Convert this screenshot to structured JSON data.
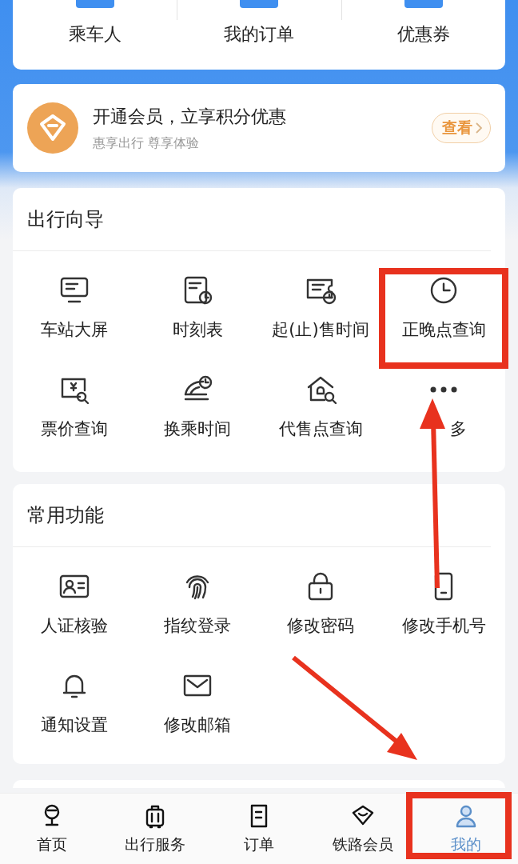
{
  "shortcuts": [
    {
      "label": "乘车人"
    },
    {
      "label": "我的订单"
    },
    {
      "label": "优惠券"
    }
  ],
  "membership_banner": {
    "title": "开通会员，立享积分优惠",
    "subtitle": "惠享出行 尊享体验",
    "button": "查看"
  },
  "sections": [
    {
      "title": "出行向导",
      "items": [
        {
          "label": "车站大屏",
          "kind": "normal"
        },
        {
          "label": "时刻表",
          "kind": "normal"
        },
        {
          "label": "起(止)售时间",
          "kind": "normal"
        },
        {
          "label": "正晚点查询",
          "kind": "normal"
        },
        {
          "label": "票价查询",
          "kind": "normal"
        },
        {
          "label": "换乘时间",
          "kind": "normal"
        },
        {
          "label": "代售点查询",
          "kind": "normal"
        },
        {
          "label": "多",
          "kind": "more"
        }
      ]
    },
    {
      "title": "常用功能",
      "items": [
        {
          "label": "人证核验",
          "kind": "normal"
        },
        {
          "label": "指纹登录",
          "kind": "normal"
        },
        {
          "label": "修改密码",
          "kind": "normal"
        },
        {
          "label": "修改手机号",
          "kind": "normal"
        },
        {
          "label": "通知设置",
          "kind": "normal"
        },
        {
          "label": "修改邮箱",
          "kind": "normal"
        }
      ]
    }
  ],
  "tab_bar": [
    {
      "label": "首页",
      "selected": false
    },
    {
      "label": "出行服务",
      "selected": false
    },
    {
      "label": "订单",
      "selected": false
    },
    {
      "label": "铁路会员",
      "selected": false
    },
    {
      "label": "我的",
      "selected": true
    }
  ]
}
